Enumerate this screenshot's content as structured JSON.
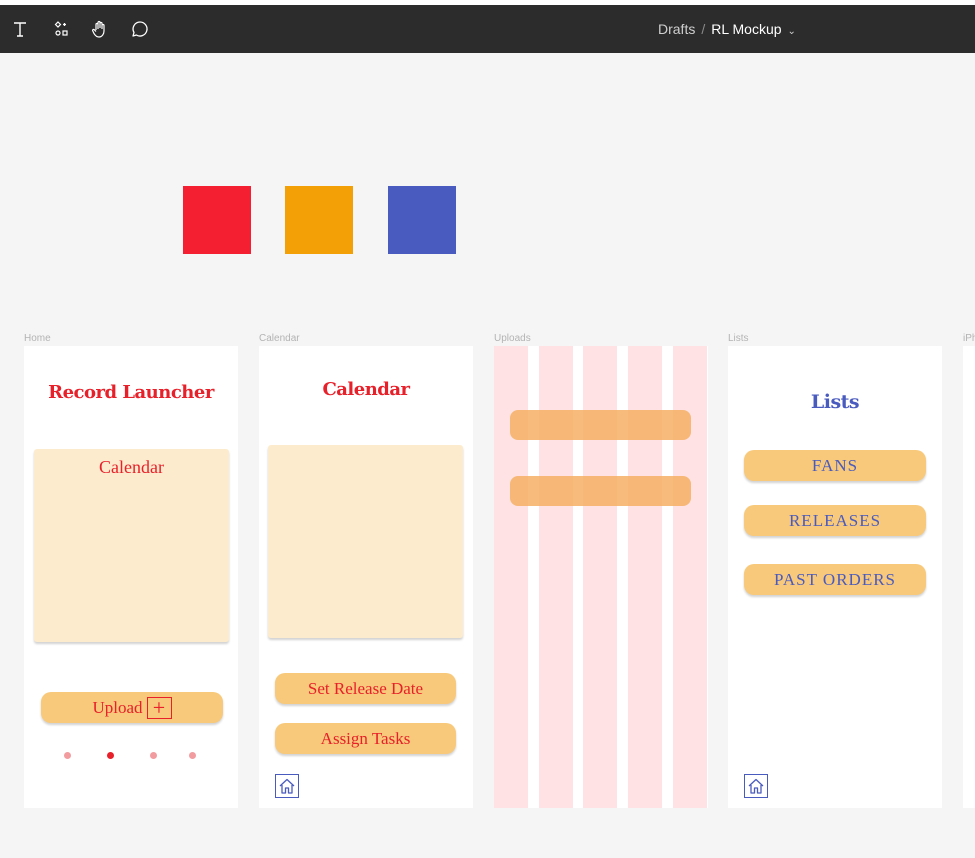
{
  "toolbar": {
    "tools": [
      {
        "name": "text-tool",
        "icon": "text-icon"
      },
      {
        "name": "component-tool",
        "icon": "components-icon"
      },
      {
        "name": "hand-tool",
        "icon": "hand-icon"
      },
      {
        "name": "comment-tool",
        "icon": "comment-icon"
      }
    ],
    "breadcrumb": {
      "folder": "Drafts",
      "separator": "/",
      "file": "RL Mockup",
      "chevron": "⌄"
    }
  },
  "swatches": [
    "#f41f31",
    "#f2a006",
    "#4a5bbf"
  ],
  "frames": {
    "home": {
      "label": "Home",
      "title": "Record Launcher",
      "card_title": "Calendar",
      "upload_label": "Upload",
      "upload_icon": "+",
      "dots": 4,
      "active_dot": 2
    },
    "calendar": {
      "label": "Calendar",
      "title": "Calendar",
      "buttons": [
        "Set Release Date",
        "Assign Tasks"
      ],
      "home_icon": "home-icon"
    },
    "uploads": {
      "label": "Uploads"
    },
    "lists": {
      "label": "Lists",
      "title": "Lists",
      "buttons": [
        "FANS",
        "RELEASES",
        "PAST ORDERS"
      ],
      "home_icon": "home-icon"
    },
    "iphone": {
      "label": "iPh"
    }
  },
  "colors": {
    "topbar": "#2c2c2c",
    "canvas": "#f5f5f5",
    "accent_red": "#e8202a",
    "accent_blue": "#4a5bbf",
    "card": "#fdebcd",
    "pill": "#f8c97a",
    "grid_column": "#ffe3e4"
  }
}
